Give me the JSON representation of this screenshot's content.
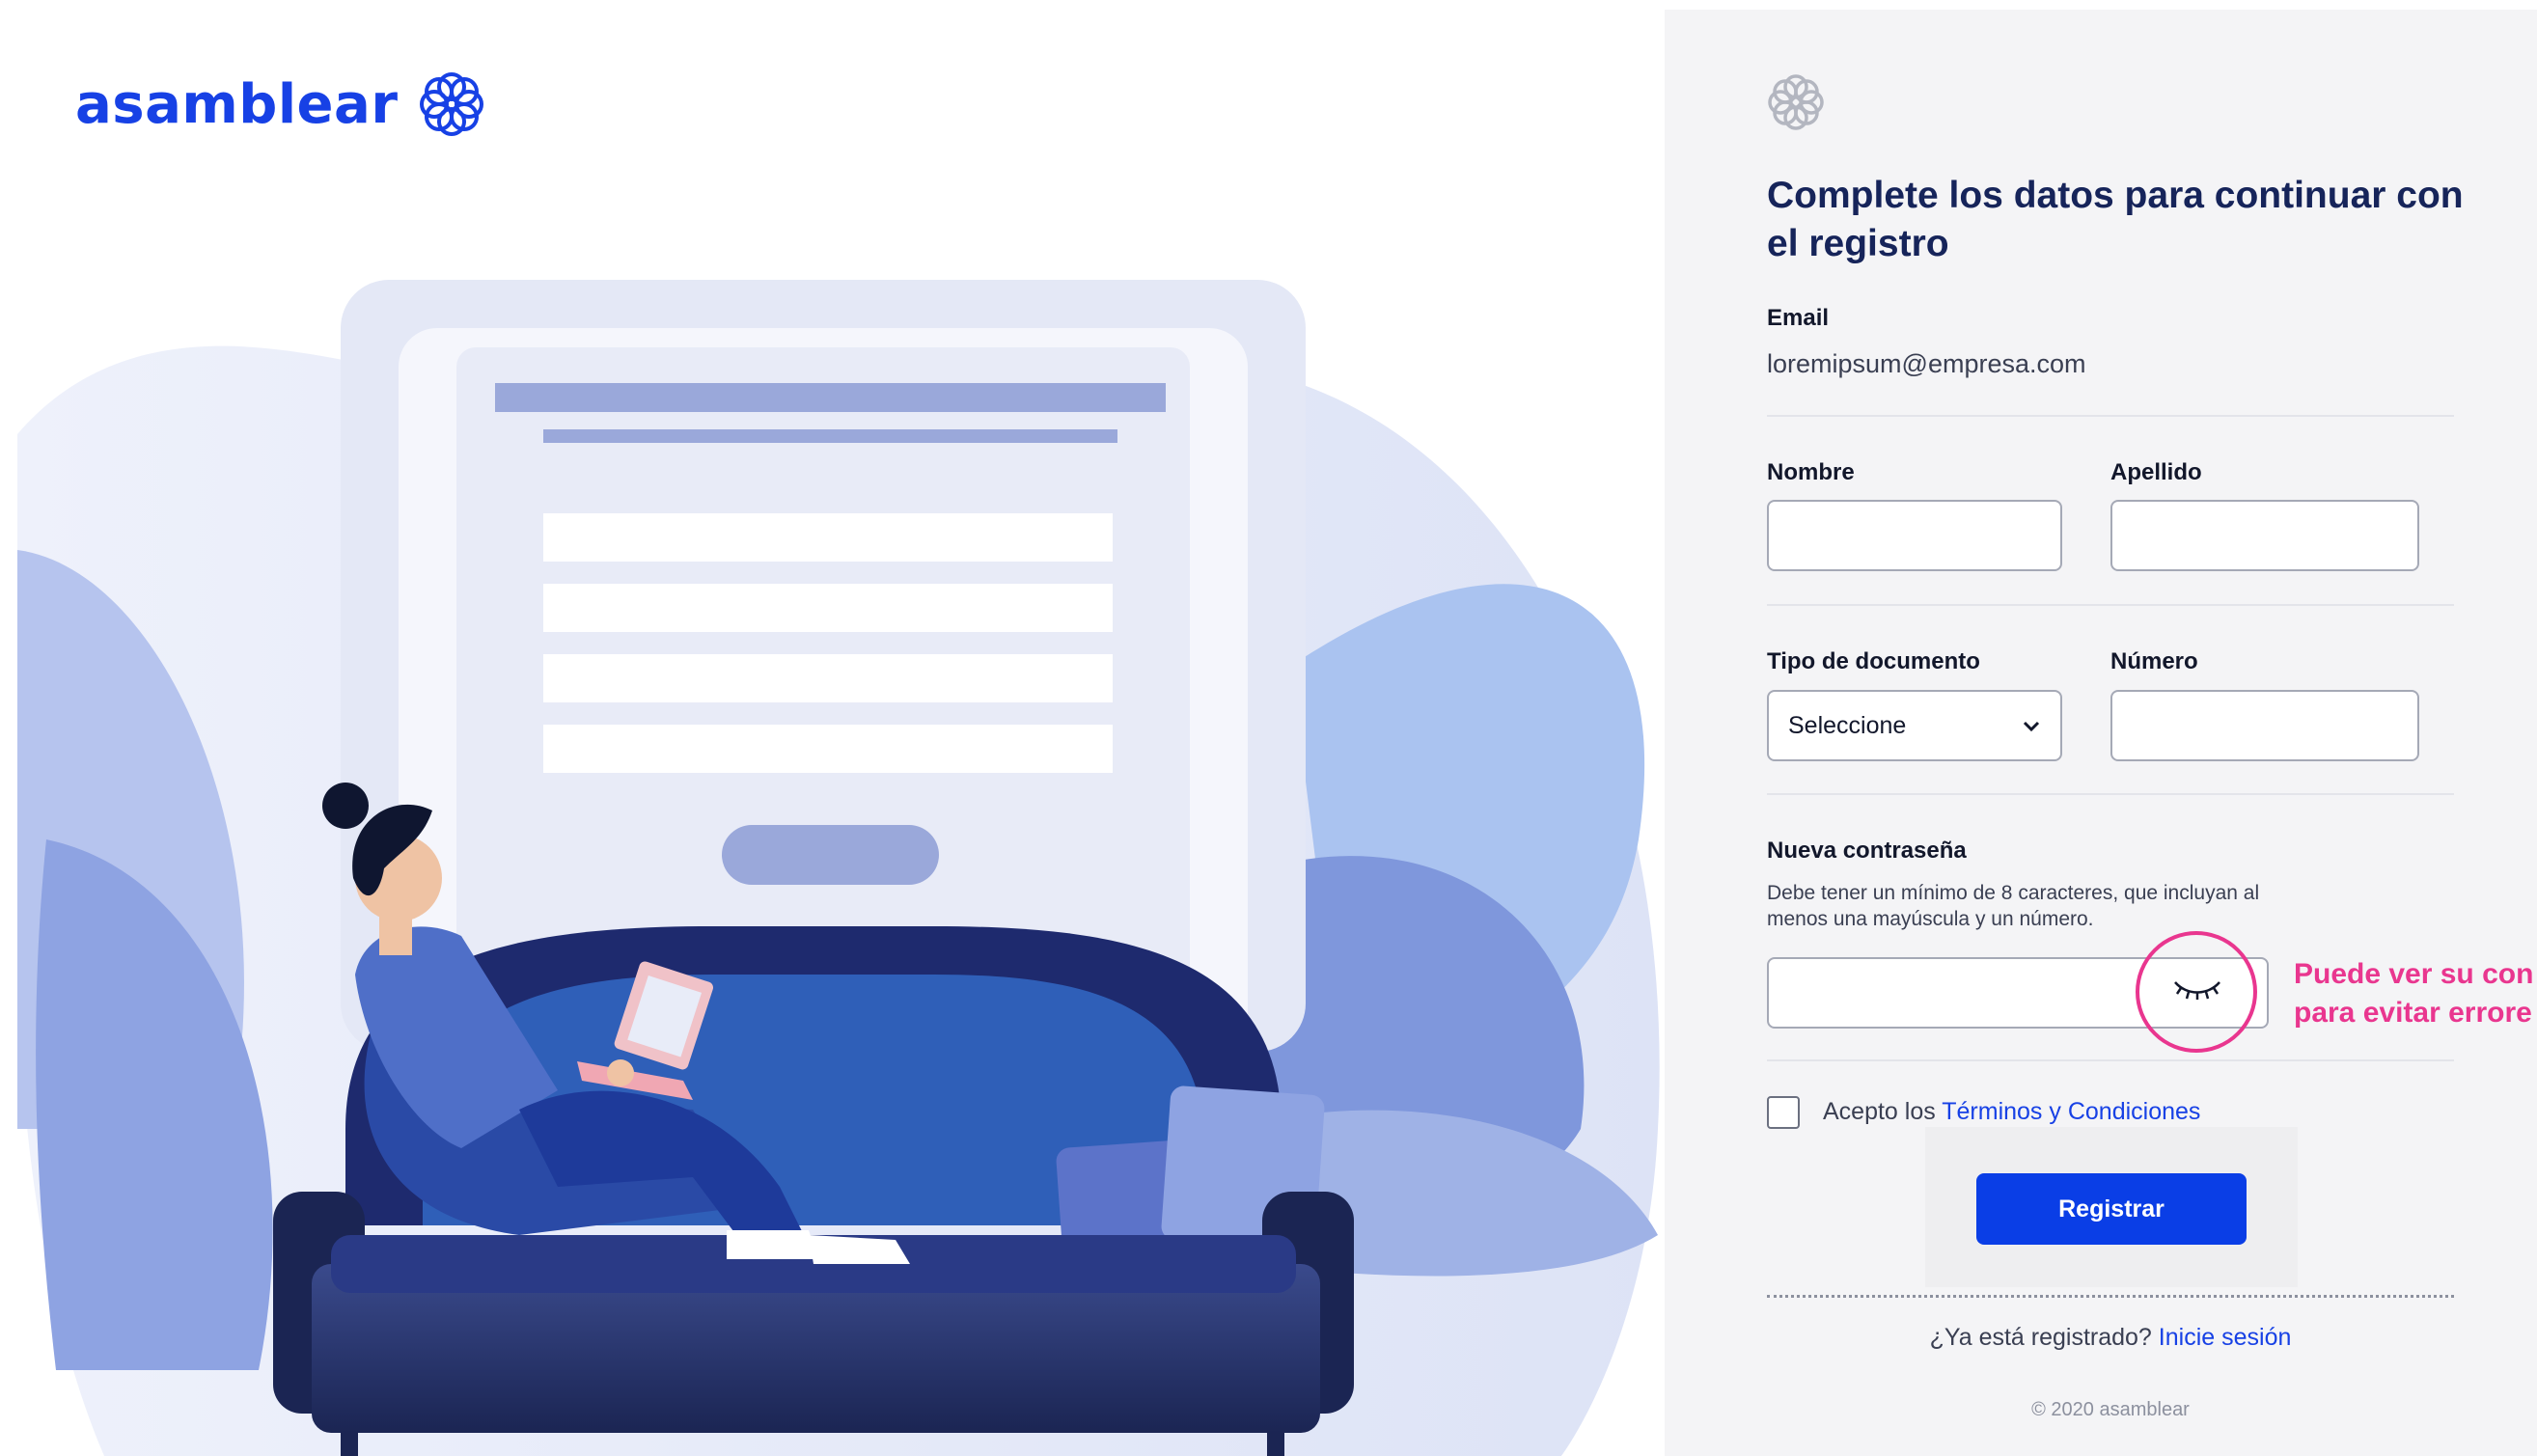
{
  "brand": {
    "name": "asamblear"
  },
  "form": {
    "title": "Complete los datos para continuar con el registro",
    "email_label": "Email",
    "email_value": "loremipsum@empresa.com",
    "nombre_label": "Nombre",
    "apellido_label": "Apellido",
    "tipo_doc_label": "Tipo de documento",
    "tipo_doc_selected": "Seleccione",
    "numero_label": "Número",
    "password_label": "Nueva contraseña",
    "password_hint": "Debe tener un mínimo de 8 caracteres, que incluyan al menos una mayúscula y un número.",
    "callout_line1": "Puede ver su con",
    "callout_line2": "para evitar errore",
    "terms_prefix": "Acepto los",
    "terms_link": "Términos y Condiciones",
    "submit_label": "Registrar",
    "login_prefix": "¿Ya está registrado?",
    "login_link": "Inicie sesión",
    "footer": "© 2020 asamblear"
  },
  "colors": {
    "brand_blue": "#1741e5",
    "button_blue": "#0a3ee6",
    "title_navy": "#16245a",
    "annotation_pink": "#e9368f",
    "panel_bg": "#f4f4f6"
  },
  "icons": {
    "brand_logo": "flower-logo-icon",
    "panel_logo": "flower-logo-icon",
    "password_toggle": "eye-closed-icon",
    "select_arrow": "chevron-down-icon"
  }
}
